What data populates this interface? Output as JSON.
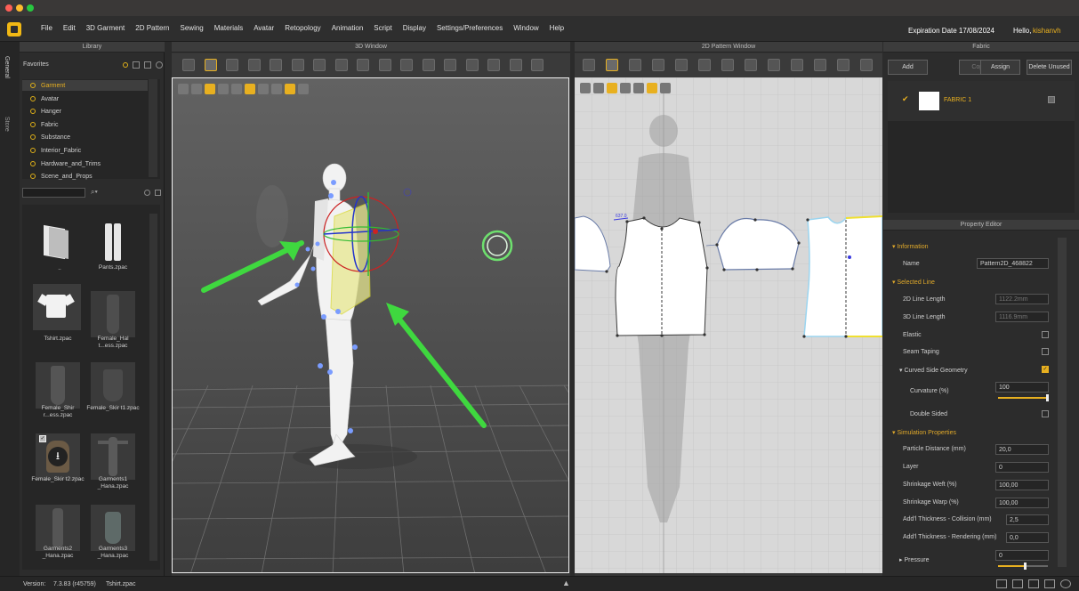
{
  "menubar": {
    "items": [
      "File",
      "Edit",
      "3D Garment",
      "2D Pattern",
      "Sewing",
      "Materials",
      "Avatar",
      "Retopology",
      "Animation",
      "Script",
      "Display",
      "Settings/Preferences",
      "Window",
      "Help"
    ],
    "expiration": "Expiration Date 17/08/2024",
    "hello": "Hello,",
    "user": "kishanvh"
  },
  "side_tabs": [
    "General",
    "Store"
  ],
  "library": {
    "title": "Library",
    "favorites": "Favorites",
    "items": [
      "Garment",
      "Avatar",
      "Hanger",
      "Fabric",
      "Substance",
      "Interior_Fabric",
      "Hardware_and_Trims",
      "Scene_and_Props"
    ],
    "files": [
      "..",
      "Pants.zpac",
      "Tshirt.zpac",
      "Female_Hal t...ess.zpac",
      "Female_Shir r...ess.zpac",
      "Female_Skir t1.zpac",
      "Female_Skir t2.zpac",
      "Garments1 _Hana.zpac",
      "Garments2 _Hana.zpac",
      "Garments3 _Hana.zpac"
    ]
  },
  "window3d": {
    "title": "3D Window"
  },
  "window2d": {
    "title": "2D Pattern Window",
    "length_label": "637.0"
  },
  "fabric": {
    "title": "Fabric",
    "buttons": [
      "Add",
      "Copy",
      "Assign",
      "Delete Unused"
    ],
    "items": [
      {
        "name": "FABRIC 1"
      }
    ]
  },
  "property_editor": {
    "title": "Property Editor",
    "information": "Information",
    "name_label": "Name",
    "name_value": "Pattern2D_468822",
    "selected_line": "Selected Line",
    "line2d_label": "2D Line Length",
    "line2d_value": "1122.2mm",
    "line3d_label": "3D Line Length",
    "line3d_value": "1116.9mm",
    "elastic": "Elastic",
    "seam_taping": "Seam Taping",
    "curved": "Curved Side Geometry",
    "curvature_label": "Curvature (%)",
    "curvature_value": "100",
    "curvature_level": 1.0,
    "double_sided": "Double Sided",
    "simulation": "Simulation Properties",
    "particle_label": "Particle Distance (mm)",
    "particle_value": "20,0",
    "layer_label": "Layer",
    "layer_value": "0",
    "weft_label": "Shrinkage Weft (%)",
    "weft_value": "100,00",
    "warp_label": "Shrinkage Warp (%)",
    "warp_value": "100,00",
    "collision_label": "Add'l Thickness - Collision (mm)",
    "collision_value": "2,5",
    "rendering_label": "Add'l Thickness - Rendering (mm)",
    "rendering_value": "0,0",
    "pressure_label": "Pressure",
    "pressure_value": "0",
    "pressure_level": 0.55
  },
  "status": {
    "version_label": "Version:",
    "version": "7.3.83 (r45759)",
    "file": "Tshirt.zpac"
  },
  "colors": {
    "accent": "#e0a92a",
    "arrow": "#3fd83f",
    "selection": "#f0e030"
  }
}
